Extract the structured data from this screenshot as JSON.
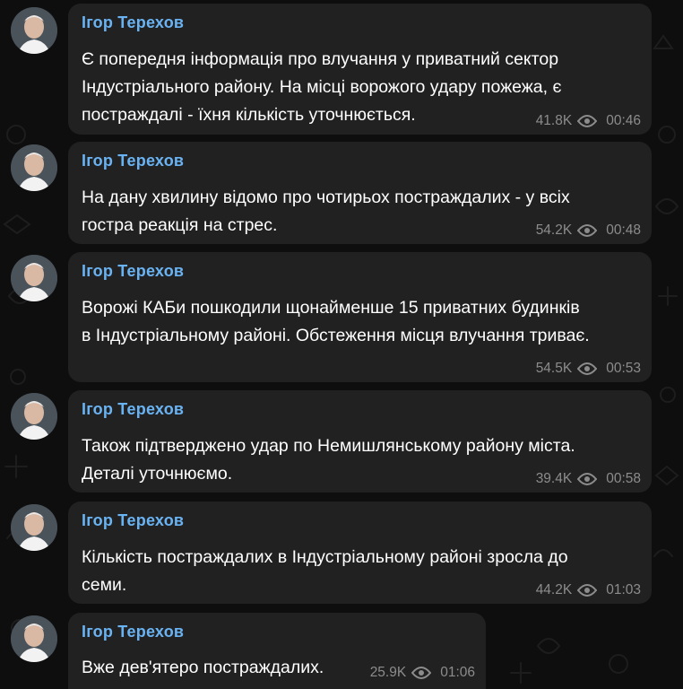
{
  "author": "Ігор Терехов",
  "messages": [
    {
      "text": "Є попередня інформація про влучання у приватний сектор\nІндустріального району. На місці ворожого удару пожежа, є\nпостраждалі - їхня кількість уточнюється.",
      "views": "41.8K",
      "time": "00:46"
    },
    {
      "text": "На дану хвилину відомо про чотирьох постраждалих - у всіх\nгостра реакція на стрес.",
      "views": "54.2K",
      "time": "00:48"
    },
    {
      "text": "Ворожі КАБи пошкодили щонайменше 15 приватних будинків\nв Індустріальному районі. Обстеження місця влучання триває.",
      "views": "54.5K",
      "time": "00:53"
    },
    {
      "text": "Також підтверджено удар по Немишлянському району міста.\nДеталі уточнюємо.",
      "views": "39.4K",
      "time": "00:58"
    },
    {
      "text": "Кількість постраждалих в Індустріальному районі зросла до\nсеми.",
      "views": "44.2K",
      "time": "01:03"
    },
    {
      "text": "Вже дев'ятеро постраждалих.",
      "views": "25.9K",
      "time": "01:06"
    }
  ],
  "colors": {
    "background": "#0e0e0e",
    "bubble": "#212121",
    "author_name": "#6ab3f3",
    "message_text": "#ffffff",
    "meta_text": "#8c8c8c"
  },
  "icons": {
    "views": "eye-icon",
    "avatar": "author-avatar"
  }
}
